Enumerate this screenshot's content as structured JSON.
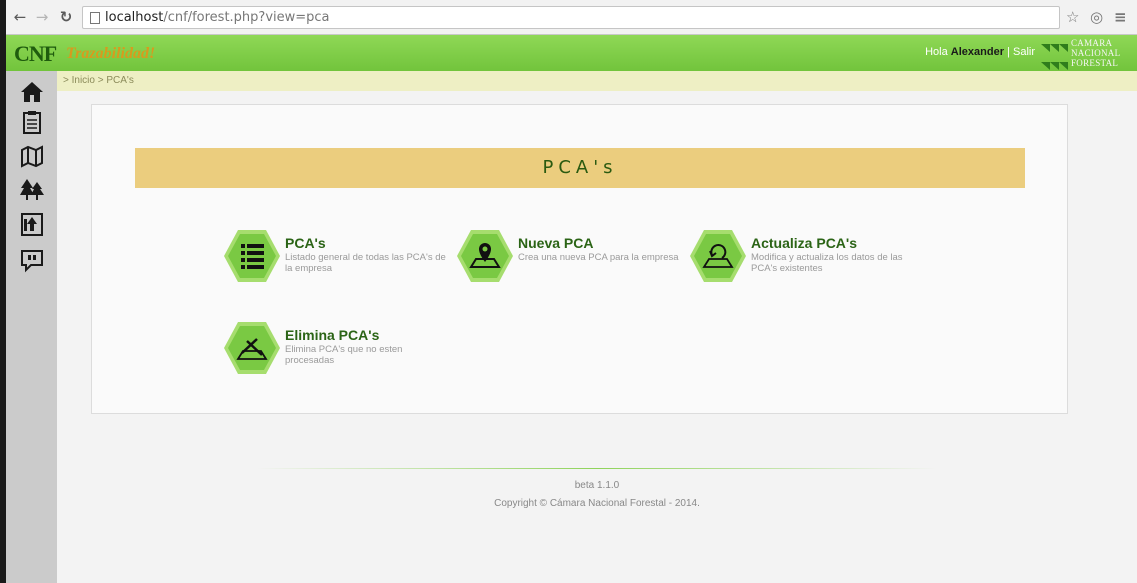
{
  "browser": {
    "url_host": "localhost",
    "url_path": "/cnf/forest.php?view=pca",
    "back_icon": "arrow-left",
    "forward_icon": "arrow-right",
    "reload_icon": "reload",
    "star_icon": "star-outline",
    "extension_icon": "circle",
    "menu_icon": "hamburger"
  },
  "header": {
    "logo_main": "CNF",
    "logo_sub": "Trazabilidad!",
    "greeting": "Hola",
    "user_name": "Alexander",
    "separator": "|",
    "logout": "Salir",
    "org_lines": [
      "CAMARA",
      "NACIONAL",
      "FORESTAL"
    ]
  },
  "sidebar": {
    "items": [
      {
        "icon": "home-icon"
      },
      {
        "icon": "clipboard-icon"
      },
      {
        "icon": "map-icon"
      },
      {
        "icon": "trees-icon"
      },
      {
        "icon": "forest-upload-icon"
      },
      {
        "icon": "comment-icon"
      }
    ]
  },
  "breadcrumb": "> Inicio > PCA's",
  "main": {
    "banner_title": "PCA's",
    "options": [
      {
        "title": "PCA's",
        "desc": "Listado general de todas las PCA's de la empresa",
        "icon": "list-icon"
      },
      {
        "title": "Nueva PCA",
        "desc": "Crea una nueva PCA para la empresa",
        "icon": "map-pin-icon"
      },
      {
        "title": "Actualiza PCA's",
        "desc": "Modifica y actualiza los datos de las PCA's existentes",
        "icon": "map-refresh-icon"
      },
      {
        "title": "Elimina PCA's",
        "desc": "Elimina PCA's que no esten procesadas",
        "icon": "map-cut-icon"
      }
    ]
  },
  "footer": {
    "version": "beta 1.1.0",
    "copyright": "Copyright © Cámara Nacional Forestal - 2014."
  },
  "colors": {
    "header_green": "#7fcf48",
    "hex_green": "#7ac943",
    "banner_gold": "#ebcd7e",
    "title_green": "#2b6416"
  }
}
